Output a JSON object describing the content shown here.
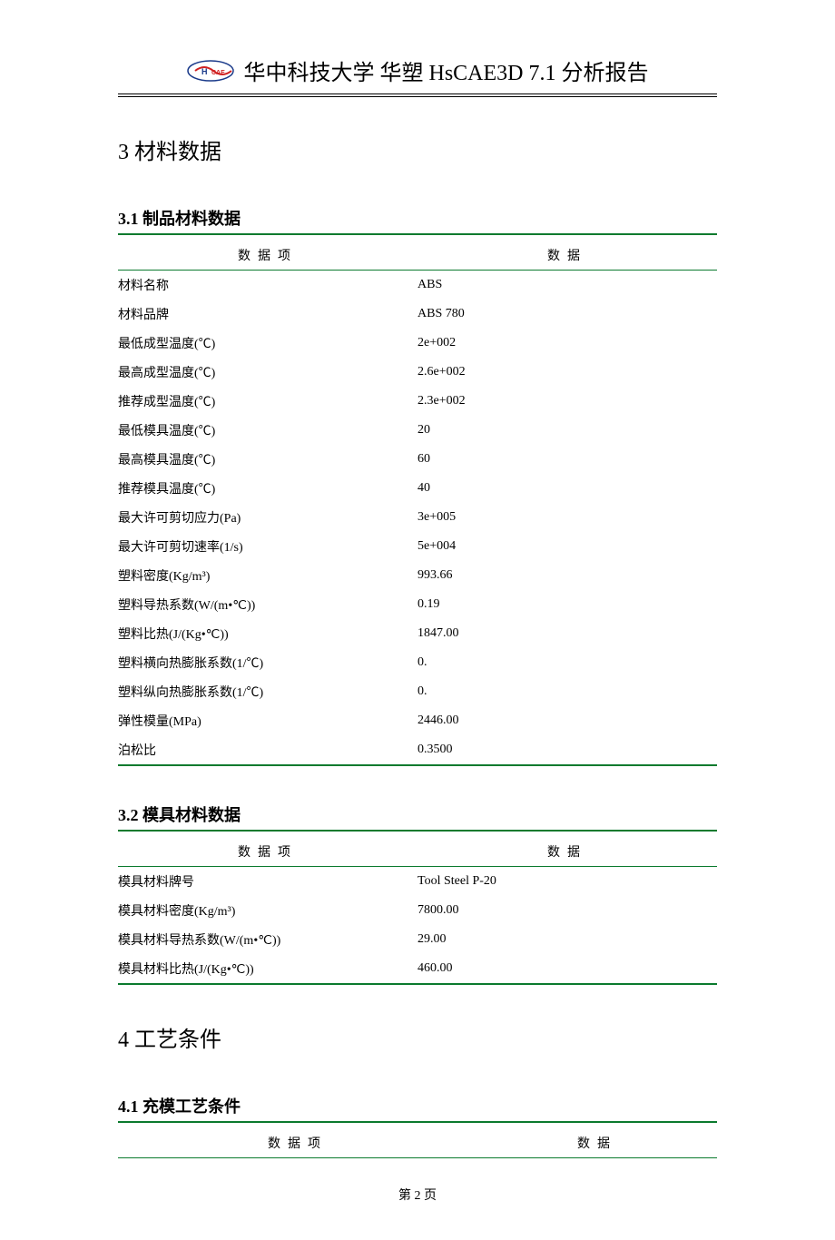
{
  "header": {
    "title": "华中科技大学 华塑 HsCAE3D 7.1 分析报告"
  },
  "section3": {
    "title": "3 材料数据",
    "sub1": {
      "title": "3.1 制品材料数据",
      "col1": "数据项",
      "col2": "数据",
      "rows": [
        {
          "label": "材料名称",
          "value": "ABS"
        },
        {
          "label": "材料品牌",
          "value": "ABS 780"
        },
        {
          "label": "最低成型温度(℃)",
          "value": "2e+002"
        },
        {
          "label": "最高成型温度(℃)",
          "value": "2.6e+002"
        },
        {
          "label": "推荐成型温度(℃)",
          "value": "2.3e+002"
        },
        {
          "label": "最低模具温度(℃)",
          "value": "20"
        },
        {
          "label": "最高模具温度(℃)",
          "value": "60"
        },
        {
          "label": "推荐模具温度(℃)",
          "value": "40"
        },
        {
          "label": "最大许可剪切应力(Pa)",
          "value": "3e+005"
        },
        {
          "label": "最大许可剪切速率(1/s)",
          "value": "5e+004"
        },
        {
          "label": "塑料密度(Kg/m³)",
          "value": "993.66"
        },
        {
          "label": "塑料导热系数(W/(m•℃))",
          "value": "0.19"
        },
        {
          "label": "塑料比热(J/(Kg•℃))",
          "value": "1847.00"
        },
        {
          "label": "塑料横向热膨胀系数(1/℃)",
          "value": "0."
        },
        {
          "label": "塑料纵向热膨胀系数(1/℃)",
          "value": "0."
        },
        {
          "label": "弹性模量(MPa)",
          "value": "2446.00"
        },
        {
          "label": "泊松比",
          "value": "0.3500"
        }
      ]
    },
    "sub2": {
      "title": "3.2 模具材料数据",
      "col1": "数据项",
      "col2": "数据",
      "rows": [
        {
          "label": "模具材料牌号",
          "value": "Tool Steel P-20"
        },
        {
          "label": "模具材料密度(Kg/m³)",
          "value": "7800.00"
        },
        {
          "label": "模具材料导热系数(W/(m•℃))",
          "value": "29.00"
        },
        {
          "label": "模具材料比热(J/(Kg•℃))",
          "value": "460.00"
        }
      ]
    }
  },
  "section4": {
    "title": "4 工艺条件",
    "sub1": {
      "title": "4.1 充模工艺条件",
      "col1": "数据项",
      "col2": "数据"
    }
  },
  "footer": {
    "pageText": "第 2 页"
  }
}
